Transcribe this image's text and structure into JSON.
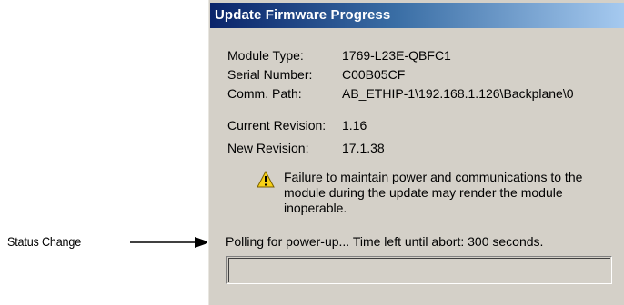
{
  "callout": {
    "label": "Status Change"
  },
  "dialog": {
    "title": "Update Firmware Progress",
    "fields": [
      {
        "label": "Module Type:",
        "value": "1769-L23E-QBFC1"
      },
      {
        "label": "Serial Number:",
        "value": "C00B05CF"
      },
      {
        "label": "Comm. Path:",
        "value": "AB_ETHIP-1\\192.168.1.126\\Backplane\\0"
      },
      {
        "label": "Current Revision:",
        "value": "1.16"
      },
      {
        "label": "New Revision:",
        "value": "17.1.38"
      }
    ],
    "warning": {
      "icon": "warning-triangle-icon",
      "text": "Failure to maintain power and communications to the module during the update may render the module inoperable."
    },
    "status": "Polling for power-up... Time left until abort: 300 seconds.",
    "progress": 0
  }
}
